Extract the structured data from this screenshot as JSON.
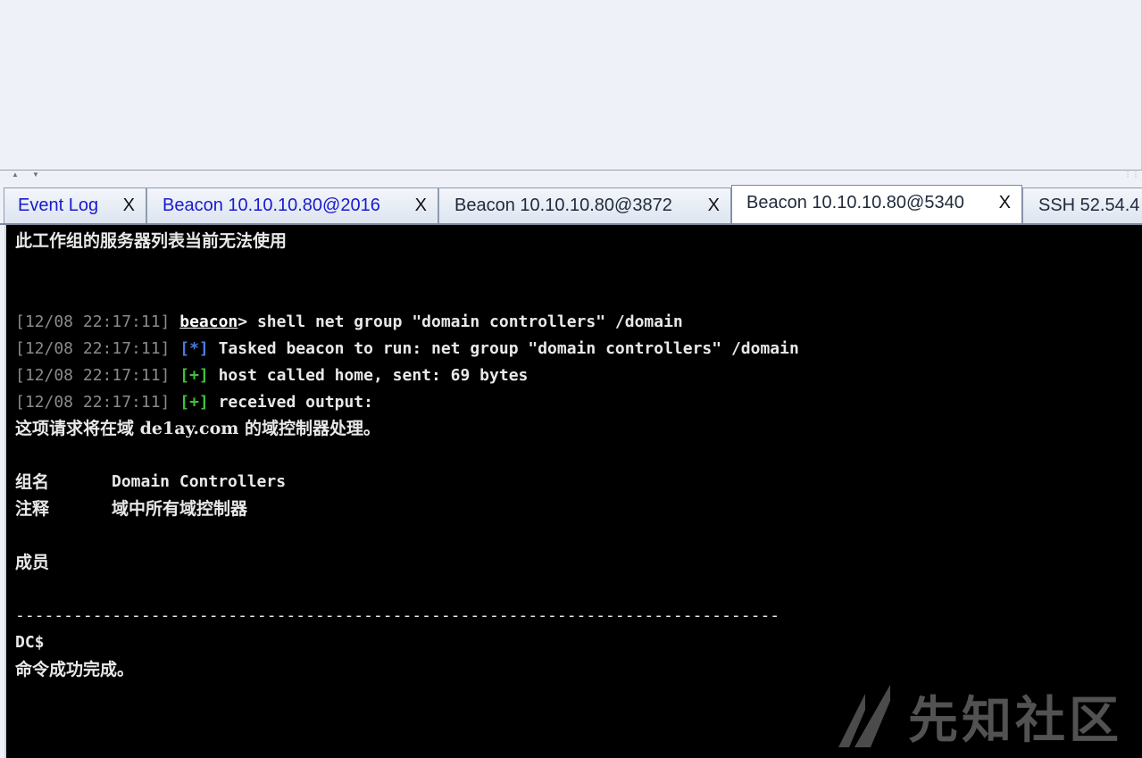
{
  "tabs": [
    {
      "label": "Event Log",
      "close": "X",
      "active": false,
      "blue": true
    },
    {
      "label": "Beacon 10.10.10.80@2016",
      "close": "X",
      "active": false,
      "blue": true
    },
    {
      "label": "Beacon 10.10.10.80@3872",
      "close": "X",
      "active": false,
      "blue": false
    },
    {
      "label": "Beacon 10.10.10.80@5340",
      "close": "X",
      "active": true,
      "blue": false
    },
    {
      "label": "SSH 52.54.4",
      "close": "",
      "active": false,
      "blue": false
    }
  ],
  "console": {
    "line0": "此工作组的服务器列表当前无法使用",
    "cmd": {
      "ts": "[12/08 22:17:11]",
      "prompt": "beacon",
      "text": "> shell net group \"domain controllers\" /domain"
    },
    "task": {
      "ts": "[12/08 22:17:11]",
      "marker": "[*]",
      "text": " Tasked beacon to run: net group \"domain controllers\" /domain"
    },
    "sent": {
      "ts": "[12/08 22:17:11]",
      "marker": "[+]",
      "text": " host called home, sent: 69 bytes"
    },
    "recv": {
      "ts": "[12/08 22:17:11]",
      "marker": "[+]",
      "text": " received output:"
    },
    "out1": "这项请求将在域 de1ay.com 的域控制器处理。",
    "group_label": "组名",
    "group_value": "Domain Controllers",
    "comment_label": "注释",
    "comment_value": "域中所有域控制器",
    "members_label": "成员",
    "separator": "-------------------------------------------------------------------------------",
    "member": "DC$",
    "done": "命令成功完成。"
  },
  "watermark": {
    "text": "先知社区",
    "icon": "xianzhi-logo-icon"
  }
}
